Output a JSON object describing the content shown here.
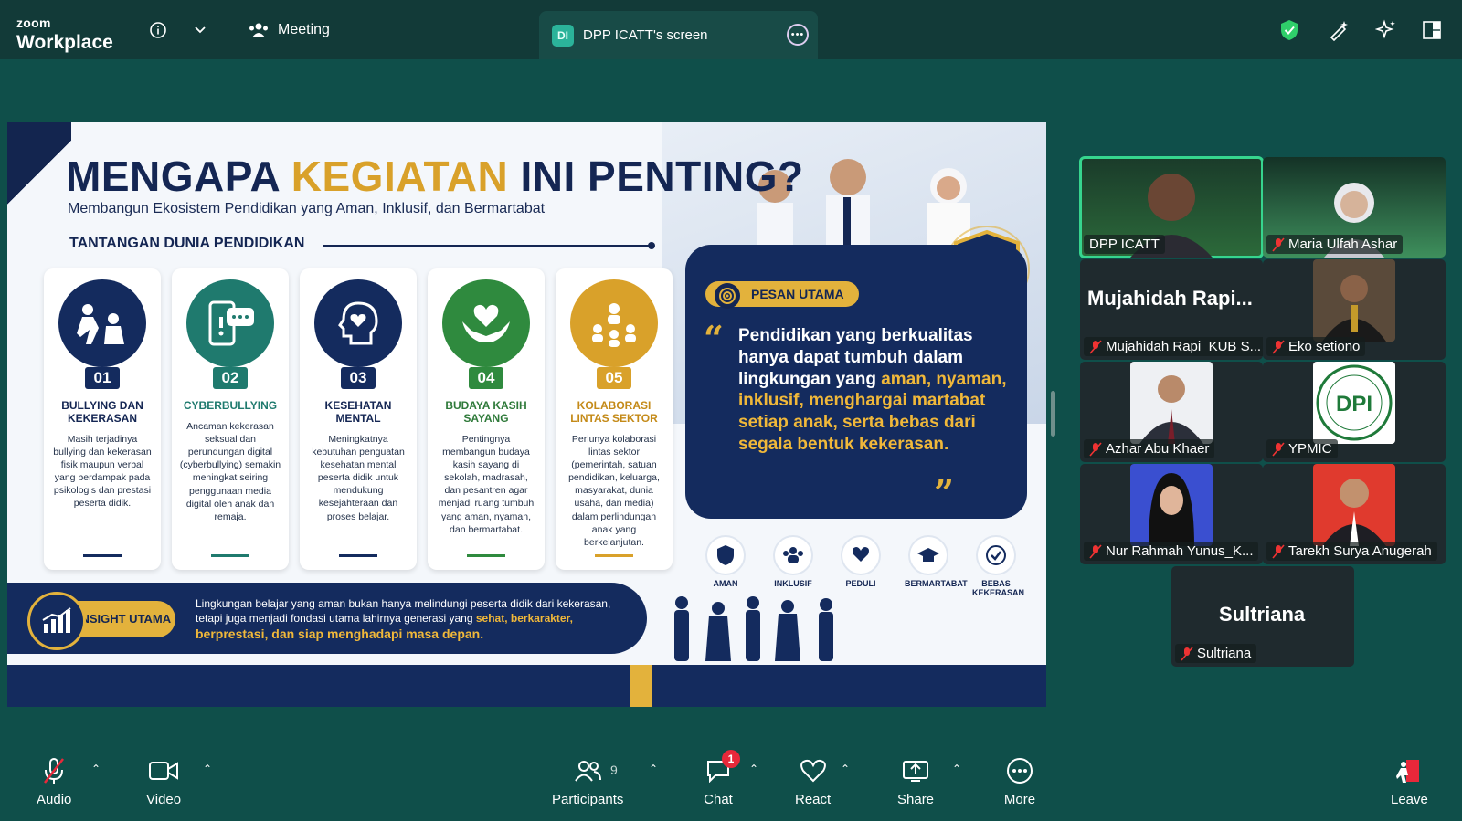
{
  "app": {
    "logo_top": "zoom",
    "logo_bottom": "Workplace",
    "meeting_label": "Meeting",
    "share_badge": "DI",
    "share_title": "DPP ICATT's screen"
  },
  "slide": {
    "title_a": "MENGAPA ",
    "title_b": "KEGIATAN",
    "title_c": " INI PENTING?",
    "subtitle": "Membangun Ekosistem Pendidikan yang Aman, Inklusif, dan Bermartabat",
    "section": "TANTANGAN DUNIA PENDIDIKAN",
    "cards": [
      {
        "num": "01",
        "title": "BULLYING DAN KEKERASAN",
        "desc": "Masih terjadinya bullying dan kekerasan fisik maupun verbal yang berdampak pada psikologis dan prestasi peserta didik.",
        "color": "#142b5e",
        "title_color": "#142653"
      },
      {
        "num": "02",
        "title": "CYBERBULLYING",
        "desc": "Ancaman kekerasan seksual dan perundungan digital (cyberbullying) semakin meningkat seiring penggunaan media digital oleh anak dan remaja.",
        "color": "#1f7a6e",
        "title_color": "#1f7a6e"
      },
      {
        "num": "03",
        "title": "KESEHATAN MENTAL",
        "desc": "Meningkatnya kebutuhan penguatan kesehatan mental peserta didik untuk mendukung kesejahteraan dan proses belajar.",
        "color": "#142b5e",
        "title_color": "#142653"
      },
      {
        "num": "04",
        "title": "BUDAYA KASIH SAYANG",
        "desc": "Pentingnya membangun budaya kasih sayang di sekolah, madrasah, dan pesantren agar menjadi ruang tumbuh yang aman, nyaman, dan bermartabat.",
        "color": "#2f8a3e",
        "title_color": "#2f7a3a"
      },
      {
        "num": "05",
        "title": "KOLABORASI LINTAS SEKTOR",
        "desc": "Perlunya kolaborasi lintas sektor (pemerintah, satuan pendidikan, keluarga, masyarakat, dunia usaha, dan media) dalam perlindungan anak yang berkelanjutan.",
        "color": "#d9a12a",
        "title_color": "#c48a18"
      }
    ],
    "pesan_label": "PESAN UTAMA",
    "pesan_open_quote": "“",
    "pesan_close_quote": "”",
    "pesan_plain": "Pendidikan yang berkualitas hanya dapat tumbuh dalam lingkungan yang ",
    "pesan_gold": "aman, nyaman, inklusif, menghargai martabat setiap anak, serta bebas dari segala bentuk kekerasan.",
    "values": [
      "AMAN",
      "INKLUSIF",
      "PEDULI",
      "BERMARTABAT",
      "BEBAS KEKERASAN"
    ],
    "insight_label": "INSIGHT UTAMA",
    "insight_plain": "Lingkungan belajar yang aman bukan hanya melindungi peserta didik dari kekerasan, tetapi juga menjadi fondasi utama lahirnya generasi yang ",
    "insight_gold1": "sehat, berkarakter,",
    "insight_gold2": "berprestasi, dan siap menghadapi masa depan."
  },
  "gallery": {
    "tiles": [
      {
        "name": "DPP ICATT",
        "muted": false,
        "active": true
      },
      {
        "name": "Maria Ulfah Ashar",
        "muted": true
      },
      {
        "name": "Mujahidah Rapi_KUB S...",
        "muted": true,
        "big": "Mujahidah  Rapi..."
      },
      {
        "name": "Eko setiono",
        "muted": true
      },
      {
        "name": "Azhar Abu Khaer",
        "muted": true
      },
      {
        "name": "YPMIC",
        "muted": true
      },
      {
        "name": "Nur Rahmah Yunus_K...",
        "muted": true
      },
      {
        "name": "Tarekh Surya Anugerah",
        "muted": true
      },
      {
        "name": "Sultriana",
        "muted": true,
        "big": "Sultriana"
      }
    ],
    "ypmic_logo_text": "DPI"
  },
  "toolbar": {
    "audio": "Audio",
    "video": "Video",
    "participants": "Participants",
    "participants_count": "9",
    "chat": "Chat",
    "chat_badge": "1",
    "react": "React",
    "share": "Share",
    "more": "More",
    "leave": "Leave"
  },
  "colors": {
    "zoom_bg": "#0f4f4a",
    "topbar_bg": "#123a38",
    "navy": "#142b5e",
    "gold": "#e3b23c",
    "active_border": "#36d58e",
    "alert_red": "#e8283a"
  }
}
